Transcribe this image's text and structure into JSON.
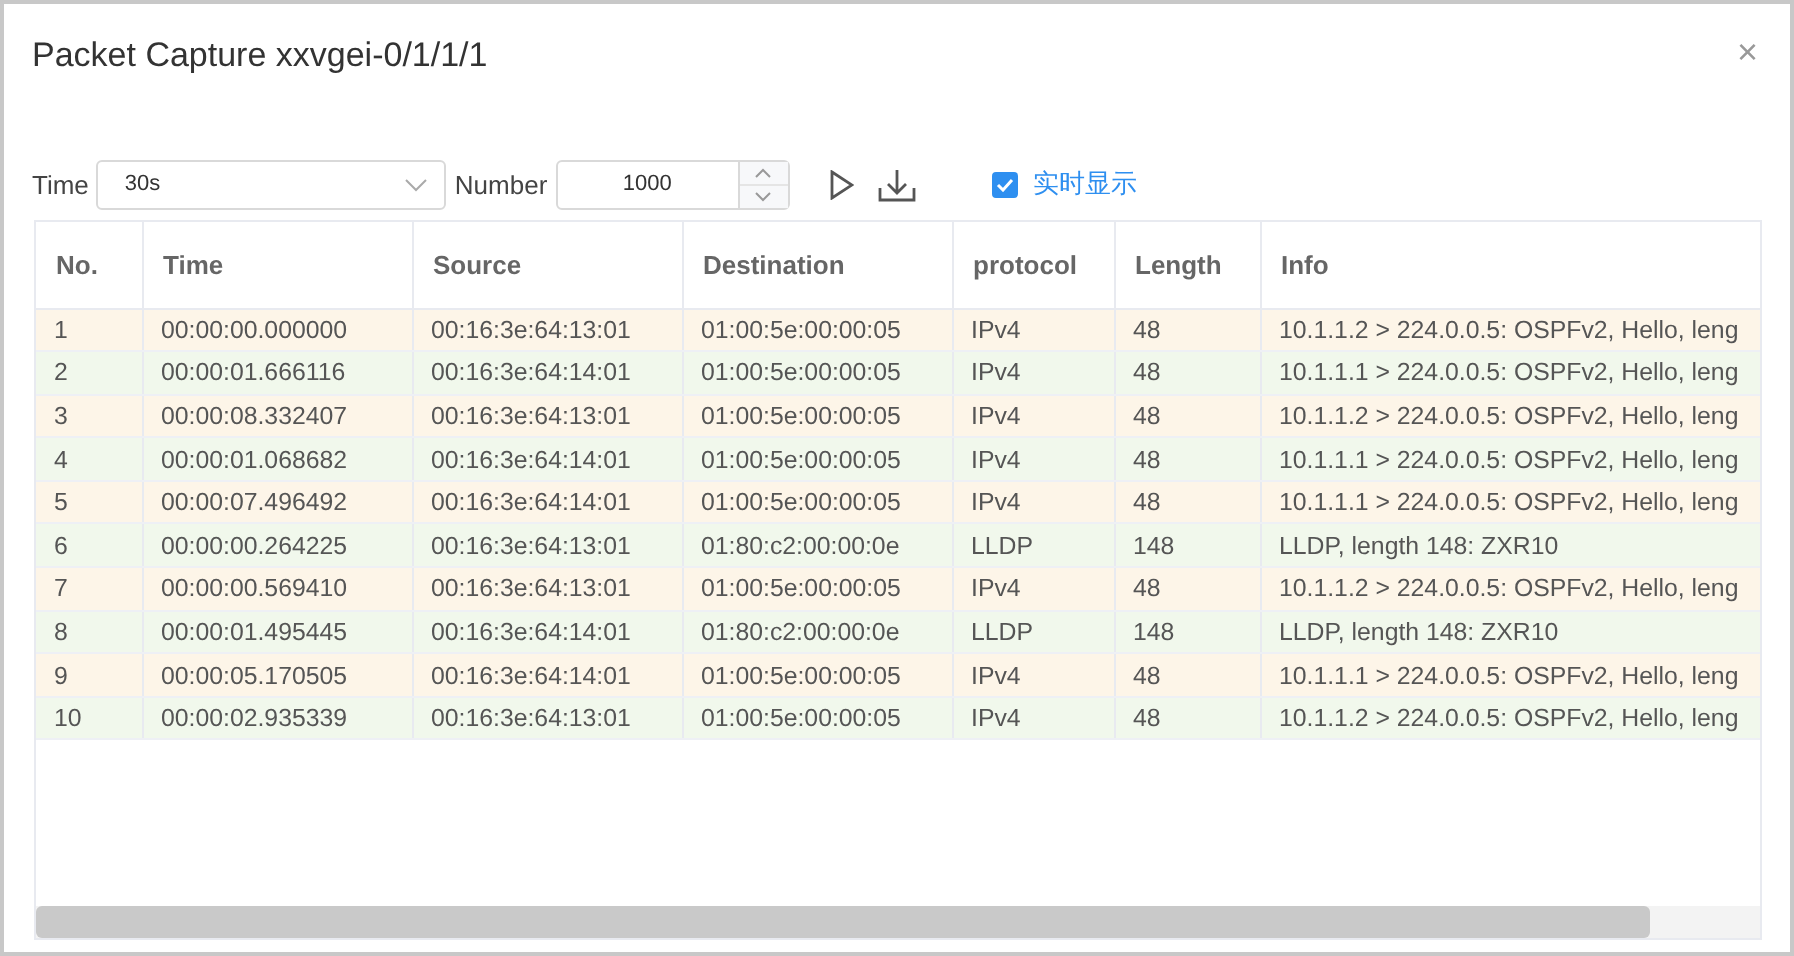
{
  "dialog": {
    "title": "Packet Capture xxvgei-0/1/1/1",
    "close": "×"
  },
  "toolbar": {
    "time_label": "Time",
    "time_value": "30s",
    "number_label": "Number",
    "number_value": "1000",
    "realtime": {
      "label": "实时显示",
      "checked": true
    }
  },
  "table": {
    "columns": [
      "No.",
      "Time",
      "Source",
      "Destination",
      "protocol",
      "Length",
      "Info"
    ],
    "rows": [
      [
        "1",
        "00:00:00.000000",
        "00:16:3e:64:13:01",
        "01:00:5e:00:00:05",
        "IPv4",
        "48",
        "10.1.1.2 > 224.0.0.5: OSPFv2, Hello, leng"
      ],
      [
        "2",
        "00:00:01.666116",
        "00:16:3e:64:14:01",
        "01:00:5e:00:00:05",
        "IPv4",
        "48",
        "10.1.1.1 > 224.0.0.5: OSPFv2, Hello, leng"
      ],
      [
        "3",
        "00:00:08.332407",
        "00:16:3e:64:13:01",
        "01:00:5e:00:00:05",
        "IPv4",
        "48",
        "10.1.1.2 > 224.0.0.5: OSPFv2, Hello, leng"
      ],
      [
        "4",
        "00:00:01.068682",
        "00:16:3e:64:14:01",
        "01:00:5e:00:00:05",
        "IPv4",
        "48",
        "10.1.1.1 > 224.0.0.5: OSPFv2, Hello, leng"
      ],
      [
        "5",
        "00:00:07.496492",
        "00:16:3e:64:14:01",
        "01:00:5e:00:00:05",
        "IPv4",
        "48",
        "10.1.1.1 > 224.0.0.5: OSPFv2, Hello, leng"
      ],
      [
        "6",
        "00:00:00.264225",
        "00:16:3e:64:13:01",
        "01:80:c2:00:00:0e",
        "LLDP",
        "148",
        "LLDP, length 148: ZXR10"
      ],
      [
        "7",
        "00:00:00.569410",
        "00:16:3e:64:13:01",
        "01:00:5e:00:00:05",
        "IPv4",
        "48",
        "10.1.1.2 > 224.0.0.5: OSPFv2, Hello, leng"
      ],
      [
        "8",
        "00:00:01.495445",
        "00:16:3e:64:14:01",
        "01:80:c2:00:00:0e",
        "LLDP",
        "148",
        "LLDP, length 148: ZXR10"
      ],
      [
        "9",
        "00:00:05.170505",
        "00:16:3e:64:14:01",
        "01:00:5e:00:00:05",
        "IPv4",
        "48",
        "10.1.1.1 > 224.0.0.5: OSPFv2, Hello, leng"
      ],
      [
        "10",
        "00:00:02.935339",
        "00:16:3e:64:13:01",
        "01:00:5e:00:00:05",
        "IPv4",
        "48",
        "10.1.1.2 > 224.0.0.5: OSPFv2, Hello, leng"
      ]
    ]
  }
}
